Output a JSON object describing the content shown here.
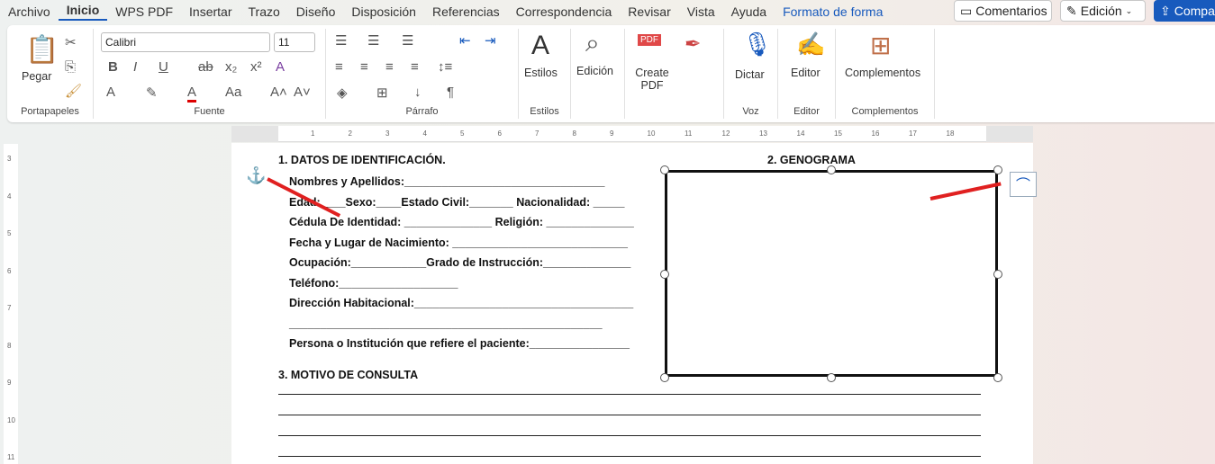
{
  "tabs": [
    "Archivo",
    "Inicio",
    "WPS PDF",
    "Insertar",
    "Trazo",
    "Diseño",
    "Disposición",
    "Referencias",
    "Correspondencia",
    "Revisar",
    "Vista",
    "Ayuda",
    "Formato de forma"
  ],
  "top_buttons": {
    "comments": "Comentarios",
    "editing": "Edición",
    "share": "Compa"
  },
  "ribbon": {
    "clipboard": {
      "paste": "Pegar",
      "label": "Portapapeles"
    },
    "font": {
      "name": "Calibri",
      "size": "11",
      "label": "Fuente"
    },
    "paragraph": {
      "label": "Párrafo"
    },
    "styles": {
      "button": "Estilos",
      "label": "Estilos"
    },
    "editing": {
      "button": "Edición"
    },
    "pdf": {
      "button": "Create PDF"
    },
    "voice": {
      "button": "Dictar",
      "label": "Voz"
    },
    "editor": {
      "button": "Editor",
      "label": "Editor"
    },
    "addins": {
      "button": "Complementos",
      "label": "Complementos"
    }
  },
  "ruler": [
    "1",
    "2",
    "3",
    "4",
    "5",
    "6",
    "7",
    "8",
    "9",
    "10",
    "11",
    "12",
    "13",
    "14",
    "15",
    "16",
    "17",
    "18"
  ],
  "vruler": [
    "3",
    "4",
    "5",
    "6",
    "7",
    "8",
    "9",
    "10",
    "11"
  ],
  "doc": {
    "section1": "1. DATOS DE IDENTIFICACIÓN.",
    "section2": "2. GENOGRAMA",
    "section3": "3. MOTIVO DE CONSULTA",
    "lines": [
      "Nombres y Apellidos:________________________________",
      "Edad:____Sexo:____Estado Civil:_______ Nacionalidad: _____",
      "Cédula De Identidad: ______________ Religión: ______________",
      "Fecha y Lugar de Nacimiento: ____________________________",
      "Ocupación:____________Grado de Instrucción:______________",
      "Teléfono:___________________",
      "Dirección Habitacional:___________________________________",
      "__________________________________________________",
      "Persona o Institución que refiere el paciente:________________"
    ]
  }
}
